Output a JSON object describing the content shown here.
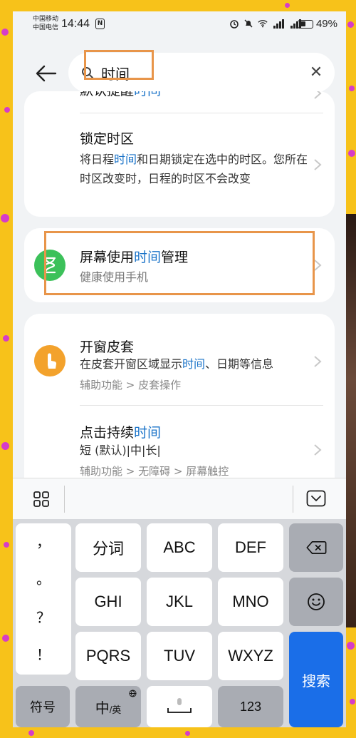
{
  "status_bar": {
    "carrier_1": "中国移动",
    "carrier_2": "中国电信",
    "time": "14:44",
    "nfc": "N",
    "battery": "49%"
  },
  "search": {
    "query": "时间"
  },
  "results": [
    {
      "title_pre": "默认提醒",
      "title_hl": "时间",
      "title_post": ""
    },
    {
      "title": "锁定时区",
      "sub_pre": "将日程",
      "sub_hl": "时间",
      "sub_post": "和日期锁定在选中的时区。您所在时区改变时，日程的时区不会改变"
    },
    {
      "title_pre": "屏幕使用",
      "title_hl": "时间",
      "title_post": "管理",
      "sub": "健康使用手机",
      "icon": "hourglass-icon",
      "icon_color": "#3cc15a"
    },
    {
      "title": "开窗皮套",
      "sub_pre": "在皮套开窗区域显示",
      "sub_hl": "时间",
      "sub_post": "、日期等信息",
      "path": "辅助功能 > 皮套操作",
      "icon": "touch-hand-icon",
      "icon_color": "#f3a22c"
    },
    {
      "title_pre": "点击持续",
      "title_hl": "时间",
      "title_post": "",
      "sub": "短 (默认)|中|长|",
      "path": "辅助功能 > 无障碍 > 屏幕触控"
    }
  ],
  "keyboard": {
    "punct": [
      "，",
      "。",
      "？",
      "！"
    ],
    "row1": [
      "分词",
      "ABC",
      "DEF"
    ],
    "row2": [
      "GHI",
      "JKL",
      "MNO"
    ],
    "row3": [
      "PQRS",
      "TUV",
      "WXYZ"
    ],
    "symbols": "符号",
    "lang_main": "中",
    "lang_alt": "/英",
    "numbers": "123",
    "search": "搜索"
  },
  "colors": {
    "highlight": "#1a73c8",
    "annotation": "#e8954a",
    "accent_key": "#1a6ee8"
  }
}
